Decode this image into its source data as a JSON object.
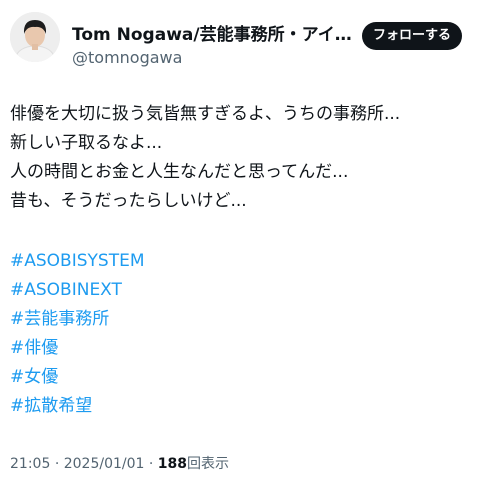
{
  "profile": {
    "display_name": "Tom Nogawa/芸能事務所・アイ...",
    "handle": "@tomnogawa",
    "follow_label": "フォローする"
  },
  "tweet": {
    "lines": [
      "俳優を大切に扱う気皆無すぎるよ、うちの事務所...",
      "新しい子取るなよ...",
      "人の時間とお金と人生なんだと思ってんだ...",
      "昔も、そうだったらしいけど..."
    ],
    "hashtags": [
      "#ASOBISYSTEM",
      "#ASOBINEXT",
      "#芸能事務所",
      "#俳優",
      "#女優",
      "#拡散希望"
    ]
  },
  "meta": {
    "time": "21:05",
    "separator": "·",
    "date": "2025/01/01",
    "views_count": "188",
    "views_label": "回表示"
  }
}
